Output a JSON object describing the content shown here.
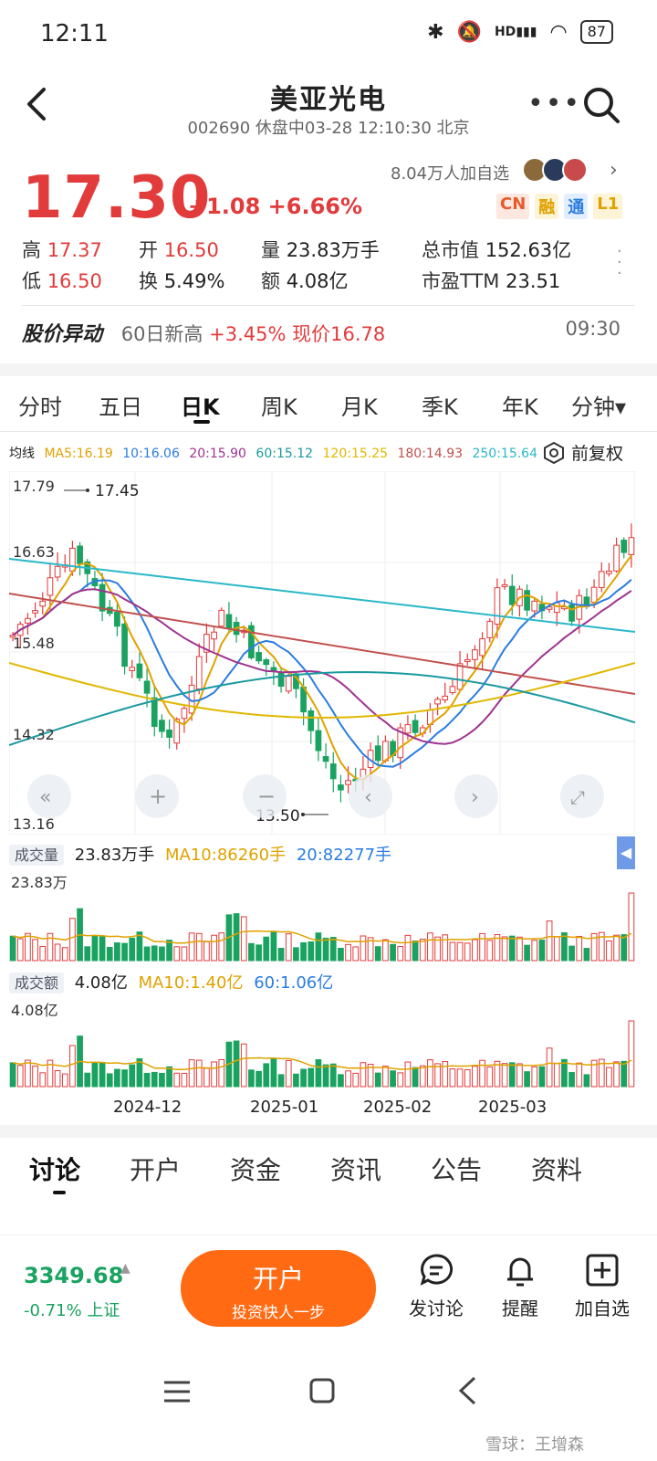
{
  "status_bar": {
    "time": "12:11",
    "battery": "87",
    "signal_label": "HD"
  },
  "header": {
    "title": "美亚光电",
    "subtitle": "002690 休盘中03-28 12:10:30 北京",
    "more": "•••"
  },
  "quote": {
    "price": "17.30",
    "change": "+1.08 +6.66%",
    "watchers": "8.04万人加自选",
    "badges": [
      {
        "label": "CN",
        "color": "#e85a2a",
        "bg": "#fde8e0"
      },
      {
        "label": "融",
        "color": "#e0a200",
        "bg": "#fdf3d6"
      },
      {
        "label": "通",
        "color": "#2a7de1",
        "bg": "#e3efff"
      },
      {
        "label": "L1",
        "color": "#e0a200",
        "bg": "#fdf3d6"
      }
    ],
    "stats": {
      "high_k": "高",
      "high_v": "17.37",
      "open_k": "开",
      "open_v": "16.50",
      "vol_k": "量",
      "vol_v": "23.83万手",
      "cap_k": "总市值",
      "cap_v": "152.63亿",
      "low_k": "低",
      "low_v": "16.50",
      "turn_k": "换",
      "turn_v": "5.49%",
      "amt_k": "额",
      "amt_v": "4.08亿",
      "pe_k": "市盈TTM",
      "pe_v": "23.51"
    }
  },
  "alert": {
    "title": "股价异动",
    "text1": "60日新高",
    "text2": "+3.45% 现价16.78",
    "time": "09:30"
  },
  "period_tabs": [
    "分时",
    "五日",
    "日K",
    "周K",
    "月K",
    "季K",
    "年K",
    "分钟▾"
  ],
  "ma_legend": {
    "label": "均线",
    "items": [
      {
        "text": "MA5:16.19",
        "color": "#e0a200"
      },
      {
        "text": "10:16.06",
        "color": "#2a7de1"
      },
      {
        "text": "20:15.90",
        "color": "#a0338f"
      },
      {
        "text": "60:15.12",
        "color": "#1a9aa0"
      },
      {
        "text": "120:15.25",
        "color": "#e0b800"
      },
      {
        "text": "180:14.93",
        "color": "#c0504d"
      },
      {
        "text": "250:15.64",
        "color": "#2bb8c8"
      }
    ],
    "adjust": "前复权"
  },
  "price_axis": [
    "17.79",
    "16.63",
    "15.48",
    "14.32",
    "13.16"
  ],
  "annotations": {
    "high": "17.45",
    "low": "13.50"
  },
  "volume": {
    "label": "成交量",
    "value": "23.83万手",
    "ma10": "MA10:86260手",
    "ma20": "20:82277手",
    "max": "23.83万"
  },
  "amount": {
    "label": "成交额",
    "value": "4.08亿",
    "ma10": "MA10:1.40亿",
    "ma60": "60:1.06亿",
    "max": "4.08亿"
  },
  "date_axis": [
    "2024-12",
    "2025-01",
    "2025-02",
    "2025-03"
  ],
  "content_tabs": [
    "讨论",
    "开户",
    "资金",
    "资讯",
    "公告",
    "资料"
  ],
  "bottom_bar": {
    "index_value": "3349.68",
    "index_change": "-0.71% 上证",
    "open_l1": "开户",
    "open_l2": "投资快人一步",
    "discuss": "发讨论",
    "remind": "提醒",
    "add": "加自选"
  },
  "watermark": "雪球：王增森",
  "colors": {
    "up": "#e23b3b",
    "down": "#1aa260",
    "accent": "#ff6a13"
  }
}
